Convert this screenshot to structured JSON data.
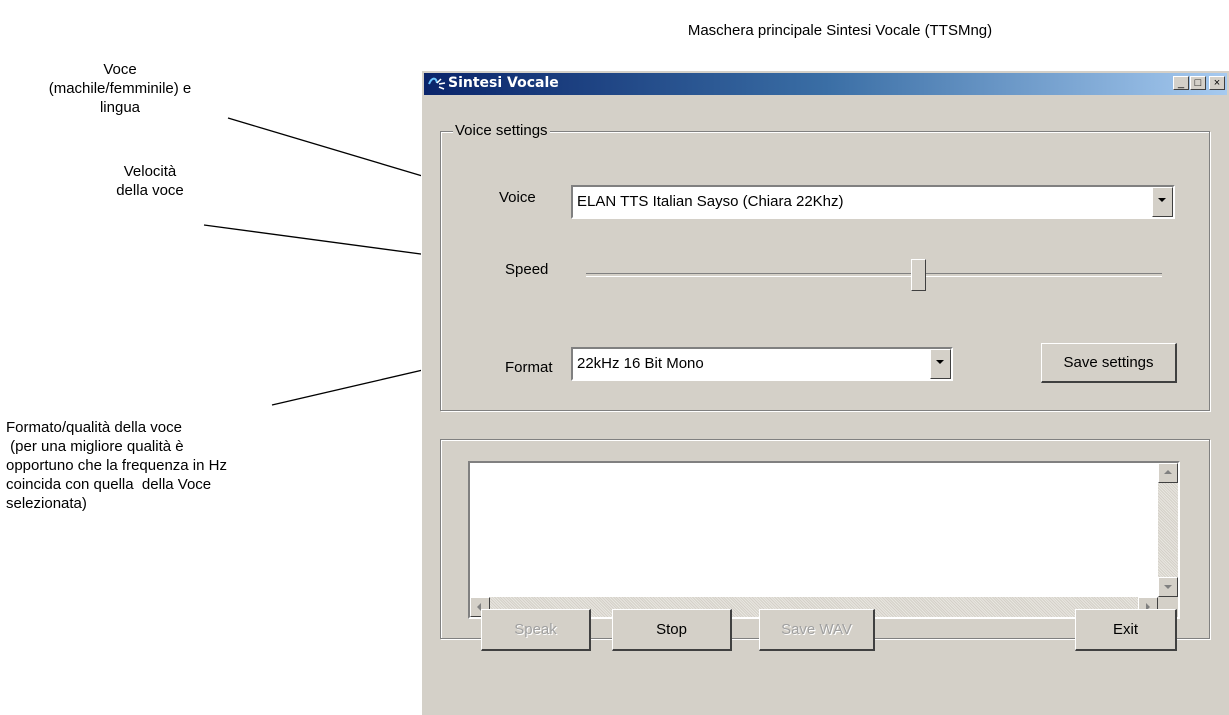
{
  "caption": "Maschera principale Sintesi Vocale (TTSMng)",
  "annotations": {
    "voice": "Voce\n(machile/femminile) e\nlingua",
    "speed": "Velocità\ndella voce",
    "format": "Formato/qualità della voce\n (per una migliore qualità è\nopportuno che la frequenza in Hz\ncoincida con quella  della Voce\nselezionata)"
  },
  "window": {
    "title": "Sintesi Vocale",
    "controls": {
      "minimize": "_",
      "maximize": "□",
      "close": "×"
    }
  },
  "voice_settings": {
    "legend": "Voice settings",
    "voice_label": "Voice",
    "voice_value": "ELAN TTS Italian Sayso (Chiara 22Khz)",
    "speed_label": "Speed",
    "speed_level_fraction": 0.58,
    "format_label": "Format",
    "format_value": "22kHz 16 Bit Mono",
    "save_settings_label": "Save settings"
  },
  "text_area": {
    "value": ""
  },
  "buttons": {
    "speak": "Speak",
    "stop": "Stop",
    "save_wav": "Save WAV",
    "exit": "Exit"
  }
}
